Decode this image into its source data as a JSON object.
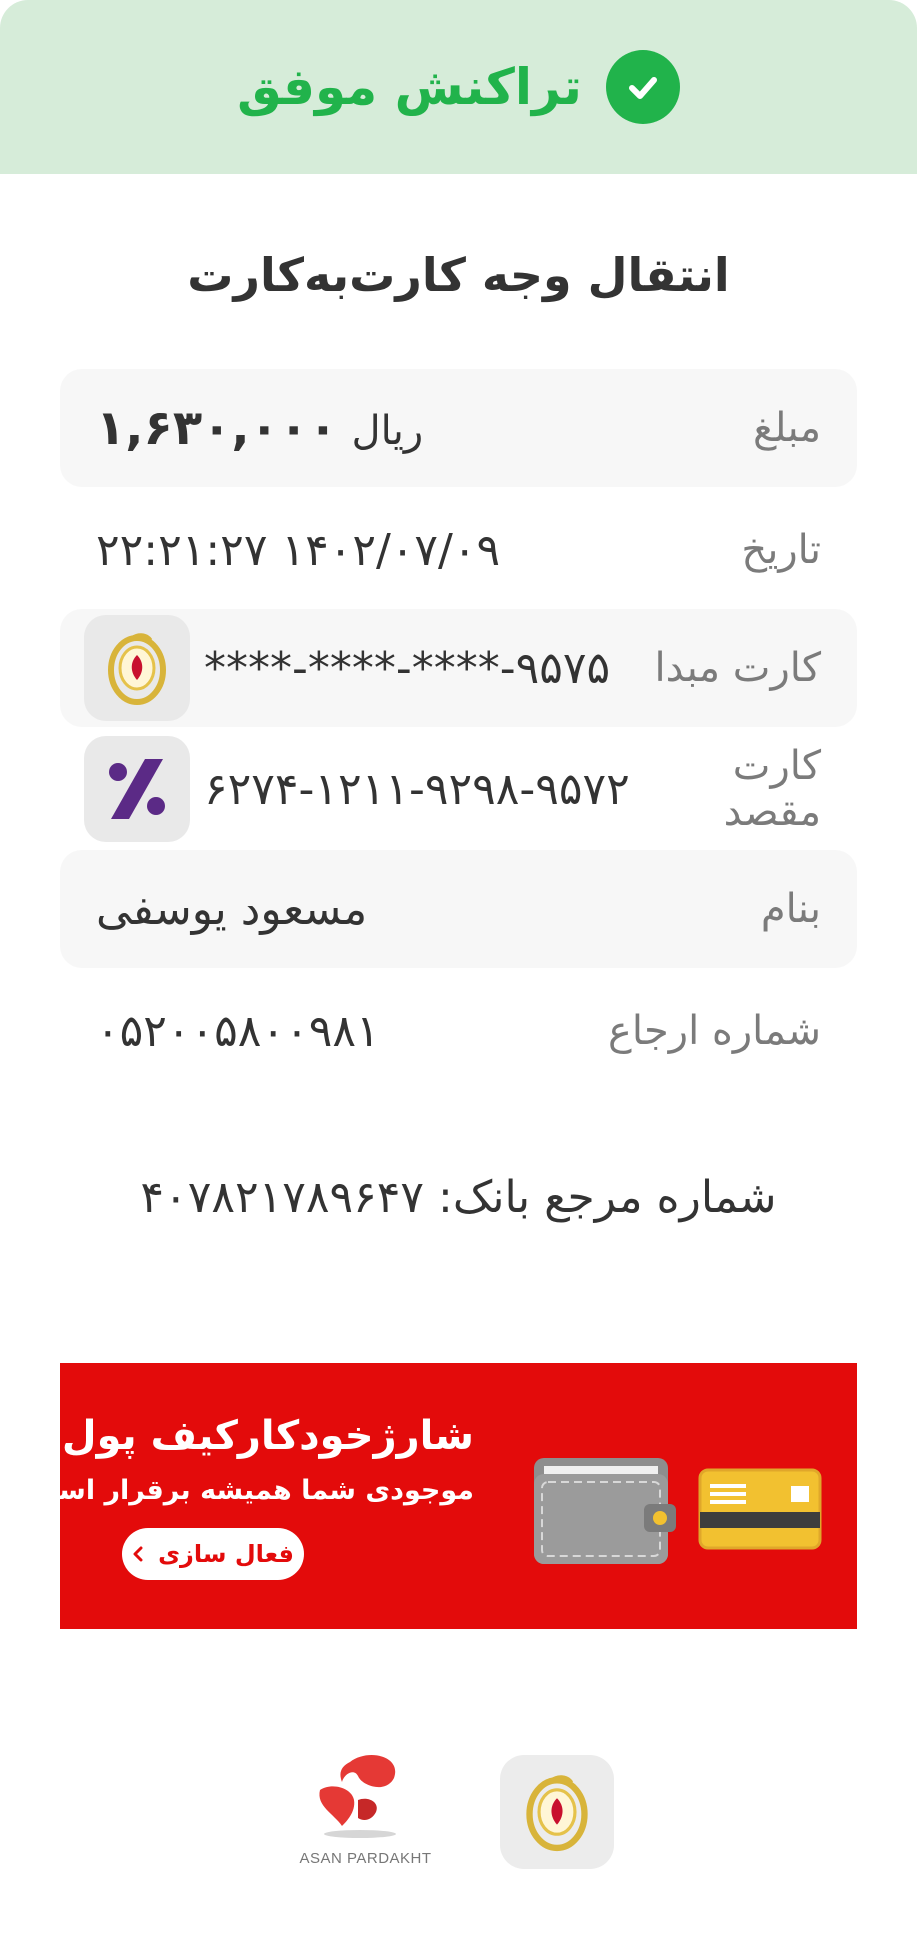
{
  "header": {
    "status_text": "تراکنش موفق",
    "check_icon": "check-circle-icon",
    "color": "#21b34b",
    "background": "#d6ecd9"
  },
  "title": "انتقال وجه کارت‌به‌کارت",
  "rows": {
    "amount": {
      "label": "مبلغ",
      "value": "۱,۶۳۰,۰۰۰",
      "unit": "ریال"
    },
    "date": {
      "label": "تاریخ",
      "value": "۲۲:۲۱:۲۷ ۱۴۰۲/۰۷/۰۹"
    },
    "source_card": {
      "label": "کارت مبدا",
      "value": "****-****-****-۹۵۷۵",
      "icon": "bank-melli-logo-icon"
    },
    "dest_card": {
      "label": "کارت مقصد",
      "value": "۶۲۷۴-۱۲۱۱-۹۲۹۸-۹۵۷۲",
      "icon": "eghtesad-novin-logo-icon"
    },
    "name": {
      "label": "بنام",
      "value": "مسعود یوسفی"
    },
    "reference": {
      "label": "شماره ارجاع",
      "value": "۰۵۲۰۰۵۸۰۰۹۸۱"
    }
  },
  "bank_reference": "شماره مرجع بانک: ۴۰۷۸۲۱۷۸۹۶۴۷",
  "banner": {
    "title": "شارژخودکارکیف پول",
    "subtitle": "موجودی شما همیشه برقرار است",
    "button_label": "فعال سازی",
    "background": "#e30b0b"
  },
  "footer": {
    "asan_caption": "ASAN PARDAKHT"
  }
}
